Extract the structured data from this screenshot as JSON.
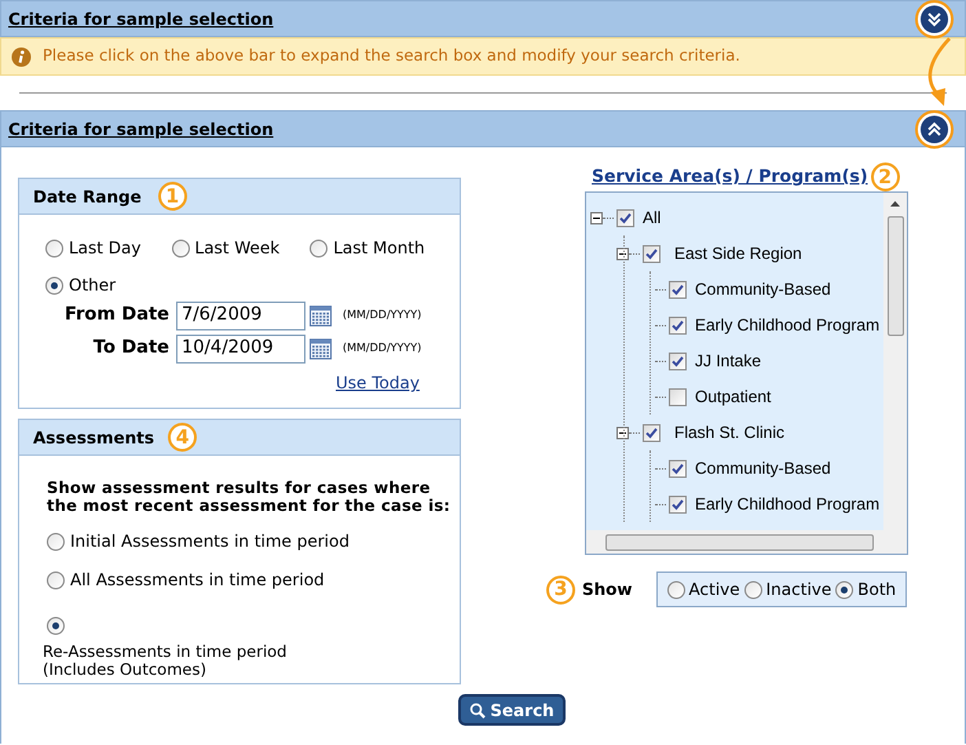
{
  "collapsed_bar": {
    "title": "Criteria for sample selection",
    "expanded": false
  },
  "info_message": {
    "text": "Please click on the above bar to expand the search box and modify your search criteria."
  },
  "expanded_bar": {
    "title": "Criteria for sample selection",
    "expanded": true
  },
  "date_range": {
    "title": "Date Range",
    "callout": "1",
    "options": [
      {
        "label": "Last Day",
        "selected": false
      },
      {
        "label": "Last Week",
        "selected": false
      },
      {
        "label": "Last Month",
        "selected": false
      },
      {
        "label": "Other",
        "selected": true
      }
    ],
    "from_date": {
      "label": "From Date",
      "value": "7/6/2009",
      "format": "(MM/DD/YYYY)"
    },
    "to_date": {
      "label": "To Date",
      "value": "10/4/2009",
      "format": "(MM/DD/YYYY)"
    },
    "use_today_link": "Use Today"
  },
  "assessments": {
    "title": "Assessments",
    "callout": "4",
    "prompt": "Show assessment results for cases where the most recent assessment for the case is:",
    "options": [
      {
        "kind": "inline",
        "label": "Initial Assessments in time period",
        "selected": false
      },
      {
        "kind": "inline",
        "label": "All Assessments in time period",
        "selected": false
      },
      {
        "kind": "stacked",
        "label": "Re-Assessments in time period",
        "note": "(Includes Outcomes)",
        "selected": true
      }
    ]
  },
  "service_area": {
    "title": "Service Area(s) / Program(s)",
    "callout": "2",
    "tree": [
      {
        "label": "All",
        "checked": true,
        "expanded": true,
        "children": [
          {
            "label": "East Side Region",
            "checked": true,
            "expanded": true,
            "children": [
              {
                "label": "Community-Based",
                "checked": true
              },
              {
                "label": "Early Childhood Program",
                "checked": true
              },
              {
                "label": "JJ Intake",
                "checked": true
              },
              {
                "label": "Outpatient",
                "checked": false
              }
            ]
          },
          {
            "label": "Flash St. Clinic",
            "checked": true,
            "expanded": true,
            "children": [
              {
                "label": "Community-Based",
                "checked": true
              },
              {
                "label": "Early Childhood Program",
                "checked": true
              }
            ]
          }
        ]
      }
    ]
  },
  "show_filter": {
    "label": "Show",
    "callout": "3",
    "options": [
      {
        "label": "Active",
        "selected": false
      },
      {
        "label": "Inactive",
        "selected": false
      },
      {
        "label": "Both",
        "selected": true
      }
    ]
  },
  "search_button": {
    "label": "Search"
  }
}
